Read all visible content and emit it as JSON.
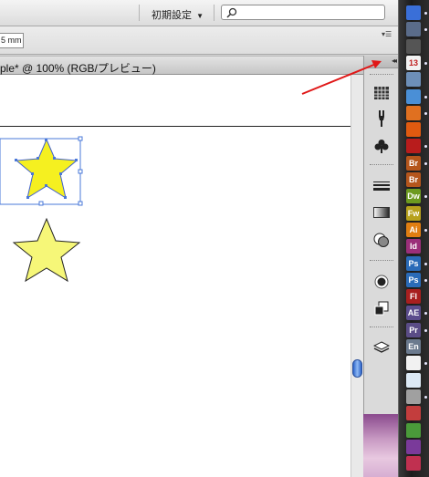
{
  "toolbar": {
    "workspace_label": "初期設定",
    "workspace_caret": "▼",
    "search_value": ""
  },
  "control": {
    "unit_value": "5 mm"
  },
  "document": {
    "tab_title": "ple* @ 100% (RGB/プレビュー)"
  },
  "panels": [
    {
      "name": "swatches",
      "icon": "swatches-icon"
    },
    {
      "name": "brushes",
      "icon": "brush-icon"
    },
    {
      "name": "symbols",
      "icon": "club-icon"
    },
    {
      "name": "stroke",
      "icon": "stroke-lines-icon"
    },
    {
      "name": "gradient",
      "icon": "gradient-icon"
    },
    {
      "name": "transparency",
      "icon": "transparency-icon"
    },
    {
      "name": "appearance",
      "icon": "appearance-icon"
    },
    {
      "name": "graphic-styles",
      "icon": "graphic-styles-icon"
    },
    {
      "name": "layers",
      "icon": "layers-icon"
    }
  ],
  "dock": [
    {
      "label": "",
      "color": "#3a6fd8",
      "icon": "finder-icon"
    },
    {
      "label": "",
      "color": "#5a6c8a",
      "icon": "spaces-icon"
    },
    {
      "label": "",
      "color": "#555555",
      "icon": "dashboard-icon"
    },
    {
      "label": "13",
      "color": "#f2f2f2",
      "icon": "calendar-icon"
    },
    {
      "label": "",
      "color": "#6d8fb8",
      "icon": "preview-icon"
    },
    {
      "label": "",
      "color": "#4a8fd6",
      "icon": "safari-icon"
    },
    {
      "label": "",
      "color": "#e07020",
      "icon": "firefox-icon"
    },
    {
      "label": "",
      "color": "#e05a10",
      "icon": "firefox-alt-icon"
    },
    {
      "label": "",
      "color": "#b81c1c",
      "icon": "acrobat-reader-icon"
    },
    {
      "label": "Br",
      "color": "#b5561c",
      "icon": "bridge-icon"
    },
    {
      "label": "Br",
      "color": "#b5561c",
      "icon": "bridge-alt-icon"
    },
    {
      "label": "Dw",
      "color": "#6c9a1f",
      "icon": "dreamweaver-icon"
    },
    {
      "label": "Fw",
      "color": "#b7a11d",
      "icon": "fireworks-icon"
    },
    {
      "label": "Ai",
      "color": "#e07e12",
      "icon": "illustrator-icon"
    },
    {
      "label": "Id",
      "color": "#9b2f7a",
      "icon": "indesign-icon"
    },
    {
      "label": "Ps",
      "color": "#2a6bb8",
      "icon": "photoshop-icon"
    },
    {
      "label": "Ps",
      "color": "#2a6bb8",
      "icon": "photoshop-alt-icon"
    },
    {
      "label": "Fl",
      "color": "#a81f1f",
      "icon": "flash-icon"
    },
    {
      "label": "AE",
      "color": "#5b4c8c",
      "icon": "after-effects-icon"
    },
    {
      "label": "Pr",
      "color": "#5a4c86",
      "icon": "premiere-icon"
    },
    {
      "label": "En",
      "color": "#6b7a8e",
      "icon": "encore-icon"
    },
    {
      "label": "",
      "color": "#f1f1f1",
      "icon": "acrobat-icon"
    },
    {
      "label": "",
      "color": "#dce9f5",
      "icon": "textedit-icon"
    },
    {
      "label": "",
      "color": "#a0a0a0",
      "icon": "archive-icon"
    },
    {
      "label": "",
      "color": "#c33d3d",
      "icon": "app-red-icon"
    },
    {
      "label": "",
      "color": "#4a9a3a",
      "icon": "app-green-icon"
    },
    {
      "label": "",
      "color": "#7a3a9a",
      "icon": "app-purple-icon"
    },
    {
      "label": "",
      "color": "#c03050",
      "icon": "app-pink-icon"
    }
  ]
}
